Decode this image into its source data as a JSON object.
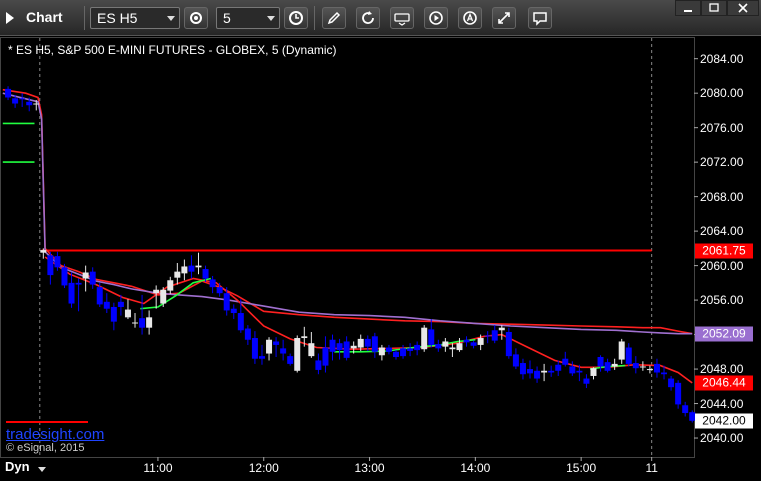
{
  "toolbar": {
    "title": "Chart",
    "symbol": "ES H5",
    "interval": "5"
  },
  "colors": {
    "up": "#e8e8e8",
    "down": "#0000ff",
    "ma_red": "#ff2020",
    "ma_violet": "#a070d0",
    "ma_green": "#20ff40",
    "level": "#ff0000"
  },
  "chart_data": {
    "type": "candlestick",
    "title": "* ES H5, S&P 500 E-MINI FUTURES - GLOBEX, 5 (Dynamic)",
    "watermark": "tradesight.com",
    "copyright": "© eSignal, 2015",
    "mode_label": "Dyn",
    "x_ticks": [
      "11:00",
      "12:00",
      "13:00",
      "14:00",
      "15:00",
      "11"
    ],
    "x_tick_minutes": [
      660,
      720,
      780,
      840,
      900,
      940
    ],
    "x_range_minutes": [
      571,
      964
    ],
    "y_ticks": [
      "2084.00",
      "2080.00",
      "2076.00",
      "2072.00",
      "2068.00",
      "2064.00",
      "2060.00",
      "2056.00",
      "2052.00",
      "2048.00",
      "2044.00",
      "2040.00"
    ],
    "ylim": [
      2037.8,
      2086.4
    ],
    "price_labels": [
      {
        "text": "2061.75",
        "value": 2061.75,
        "bg": "#ff0000",
        "fg": "#ffffff"
      },
      {
        "text": "2052.09",
        "value": 2052.09,
        "bg": "#9a6fd0",
        "fg": "#ffffff"
      },
      {
        "text": "2046.44",
        "value": 2046.44,
        "bg": "#ff0000",
        "fg": "#ffffff"
      },
      {
        "text": "2042.00",
        "value": 2042.0,
        "bg": "#ffffff",
        "fg": "#000000"
      }
    ],
    "horizontal_level": 2061.75,
    "candles": [
      [
        575,
        2080.5,
        2080.8,
        2079.2,
        2079.5
      ],
      [
        579,
        2079.4,
        2079.8,
        2078.3,
        2078.8
      ],
      [
        583,
        2079.4,
        2080.0,
        2078.4,
        2079.3
      ],
      [
        587,
        2079.0,
        2079.5,
        2077.9,
        2078.6
      ],
      [
        591,
        2078.8,
        2079.2,
        2078.0,
        2078.8
      ],
      [
        595,
        2061.5,
        2062.0,
        2060.8,
        2061.8
      ],
      [
        599,
        2061.2,
        2061.6,
        2057.8,
        2058.9
      ],
      [
        603,
        2061.1,
        2061.6,
        2059.4,
        2059.8
      ],
      [
        607,
        2059.8,
        2060.2,
        2057.4,
        2057.7
      ],
      [
        611,
        2058.0,
        2059.2,
        2055.1,
        2055.6
      ],
      [
        615,
        2058.0,
        2058.5,
        2054.7,
        2057.8
      ],
      [
        619,
        2058.5,
        2060.0,
        2057.0,
        2059.2
      ],
      [
        623,
        2059.3,
        2059.8,
        2057.3,
        2057.8
      ],
      [
        627,
        2057.5,
        2058.0,
        2055.2,
        2055.5
      ],
      [
        631,
        2055.8,
        2056.8,
        2054.5,
        2055.0
      ],
      [
        635,
        2055.2,
        2055.7,
        2052.5,
        2053.5
      ],
      [
        639,
        2055.8,
        2056.6,
        2054.2,
        2055.2
      ],
      [
        643,
        2054.0,
        2056.1,
        2053.8,
        2054.9
      ],
      [
        647,
        2053.3,
        2054.5,
        2052.8,
        2053.4
      ],
      [
        651,
        2053.9,
        2056.6,
        2052.0,
        2052.8
      ],
      [
        655,
        2052.8,
        2054.8,
        2052.0,
        2054.0
      ],
      [
        659,
        2056.8,
        2057.7,
        2055.0,
        2057.2
      ],
      [
        663,
        2055.6,
        2057.5,
        2055.2,
        2057.2
      ],
      [
        667,
        2057.1,
        2058.7,
        2056.7,
        2058.3
      ],
      [
        671,
        2058.6,
        2060.3,
        2057.8,
        2059.3
      ],
      [
        675,
        2059.1,
        2060.7,
        2058.3,
        2059.9
      ],
      [
        679,
        2060.0,
        2061.2,
        2058.5,
        2059.3
      ],
      [
        683,
        2059.8,
        2061.5,
        2059.0,
        2060.0
      ],
      [
        687,
        2059.6,
        2060.0,
        2058.1,
        2058.5
      ],
      [
        691,
        2058.4,
        2058.8,
        2056.8,
        2057.5
      ],
      [
        695,
        2057.5,
        2058.0,
        2056.4,
        2056.8
      ],
      [
        699,
        2056.8,
        2057.5,
        2054.2,
        2054.8
      ],
      [
        703,
        2055.0,
        2055.5,
        2053.8,
        2054.5
      ],
      [
        707,
        2054.5,
        2056.1,
        2052.2,
        2052.5
      ],
      [
        711,
        2052.7,
        2053.1,
        2050.8,
        2051.4
      ],
      [
        715,
        2051.6,
        2052.4,
        2048.6,
        2049.2
      ],
      [
        719,
        2049.5,
        2050.8,
        2048.5,
        2049.2
      ],
      [
        723,
        2049.8,
        2051.7,
        2049.0,
        2051.4
      ],
      [
        727,
        2051.2,
        2051.7,
        2049.4,
        2050.8
      ],
      [
        731,
        2050.4,
        2051.4,
        2049.0,
        2049.8
      ],
      [
        735,
        2049.5,
        2049.8,
        2048.4,
        2048.6
      ],
      [
        739,
        2047.8,
        2051.9,
        2047.6,
        2051.6
      ],
      [
        743,
        2051.6,
        2052.9,
        2050.6,
        2051.8
      ],
      [
        747,
        2049.5,
        2052.3,
        2049.3,
        2051.0
      ],
      [
        751,
        2049.0,
        2049.8,
        2047.4,
        2047.9
      ],
      [
        755,
        2050.5,
        2051.8,
        2047.6,
        2048.4
      ],
      [
        759,
        2051.4,
        2052.0,
        2049.0,
        2050.0
      ],
      [
        763,
        2051.0,
        2051.5,
        2049.1,
        2050.2
      ],
      [
        767,
        2051.2,
        2051.8,
        2049.0,
        2049.3
      ],
      [
        771,
        2050.4,
        2051.2,
        2049.8,
        2050.7
      ],
      [
        775,
        2050.5,
        2052.0,
        2050.1,
        2051.5
      ],
      [
        779,
        2051.5,
        2051.9,
        2050.1,
        2050.6
      ],
      [
        783,
        2051.8,
        2052.2,
        2049.3,
        2050.0
      ],
      [
        787,
        2049.6,
        2050.8,
        2049.0,
        2050.5
      ],
      [
        791,
        2050.5,
        2050.8,
        2049.7,
        2050.0
      ],
      [
        795,
        2050.0,
        2050.2,
        2049.1,
        2049.4
      ],
      [
        799,
        2050.4,
        2050.8,
        2049.2,
        2049.5
      ],
      [
        803,
        2050.4,
        2051.0,
        2049.5,
        2050.1
      ],
      [
        807,
        2050.8,
        2051.2,
        2049.6,
        2050.2
      ],
      [
        811,
        2050.3,
        2053.1,
        2050.0,
        2052.8
      ],
      [
        815,
        2052.6,
        2053.8,
        2050.5,
        2050.8
      ],
      [
        819,
        2050.9,
        2051.4,
        2050.0,
        2050.4
      ],
      [
        823,
        2050.6,
        2051.6,
        2050.0,
        2051.2
      ],
      [
        827,
        2050.3,
        2051.0,
        2049.4,
        2050.5
      ],
      [
        831,
        2050.2,
        2051.6,
        2050.0,
        2051.0
      ],
      [
        835,
        2051.4,
        2051.8,
        2050.6,
        2051.1
      ],
      [
        839,
        2051.1,
        2051.3,
        2050.4,
        2050.7
      ],
      [
        843,
        2050.8,
        2052.0,
        2050.2,
        2051.6
      ],
      [
        847,
        2051.9,
        2052.4,
        2051.0,
        2051.8
      ],
      [
        851,
        2052.5,
        2053.1,
        2051.0,
        2051.3
      ],
      [
        855,
        2052.5,
        2053.1,
        2051.4,
        2052.8
      ],
      [
        859,
        2052.3,
        2052.8,
        2049.2,
        2049.5
      ],
      [
        863,
        2049.7,
        2050.4,
        2048.0,
        2048.3
      ],
      [
        867,
        2048.7,
        2049.2,
        2046.8,
        2047.4
      ],
      [
        871,
        2048.0,
        2049.0,
        2046.9,
        2047.5
      ],
      [
        875,
        2047.8,
        2048.3,
        2046.4,
        2046.9
      ],
      [
        879,
        2047.6,
        2048.6,
        2046.6,
        2047.8
      ],
      [
        883,
        2047.8,
        2048.4,
        2047.1,
        2047.6
      ],
      [
        887,
        2048.5,
        2049.0,
        2047.2,
        2047.8
      ],
      [
        891,
        2049.2,
        2050.0,
        2048.3,
        2048.5
      ],
      [
        895,
        2048.3,
        2048.9,
        2047.2,
        2047.5
      ],
      [
        899,
        2047.8,
        2048.5,
        2046.6,
        2047.6
      ],
      [
        903,
        2046.9,
        2047.4,
        2045.8,
        2046.3
      ],
      [
        907,
        2047.2,
        2048.2,
        2046.8,
        2048.1
      ],
      [
        911,
        2049.4,
        2049.6,
        2047.7,
        2048.3
      ],
      [
        915,
        2048.8,
        2049.2,
        2047.6,
        2047.8
      ],
      [
        919,
        2048.3,
        2049.2,
        2047.9,
        2048.6
      ],
      [
        923,
        2049.1,
        2051.5,
        2048.6,
        2051.2
      ],
      [
        927,
        2050.5,
        2051.0,
        2048.3,
        2048.6
      ],
      [
        931,
        2048.7,
        2049.5,
        2047.5,
        2048.1
      ],
      [
        935,
        2048.3,
        2048.9,
        2047.8,
        2048.3
      ],
      [
        939,
        2048.0,
        2048.4,
        2047.5,
        2048.0
      ],
      [
        943,
        2048.6,
        2049.2,
        2047.0,
        2047.6
      ],
      [
        947,
        2047.6,
        2048.4,
        2046.8,
        2047.4
      ],
      [
        951,
        2046.9,
        2047.2,
        2045.5,
        2045.9
      ],
      [
        955,
        2046.4,
        2046.7,
        2043.4,
        2043.9
      ],
      [
        959,
        2043.8,
        2044.2,
        2042.5,
        2042.9
      ],
      [
        963,
        2043.0,
        2043.2,
        2041.8,
        2042.0
      ]
    ],
    "series": [
      {
        "color": "#ff2020",
        "points": [
          [
            572,
            2080.4
          ],
          [
            585,
            2080.0
          ],
          [
            592,
            2079.5
          ],
          [
            594,
            2077.5
          ],
          [
            596,
            2062.0
          ],
          [
            605,
            2060.0
          ],
          [
            615,
            2059.3
          ],
          [
            625,
            2058.4
          ],
          [
            635,
            2058.0
          ],
          [
            645,
            2057.6
          ],
          [
            660,
            2056.6
          ],
          [
            672,
            2056.8
          ],
          [
            685,
            2058.2
          ],
          [
            695,
            2057.5
          ],
          [
            705,
            2056.5
          ],
          [
            720,
            2054.7
          ],
          [
            740,
            2054.3
          ],
          [
            760,
            2054.0
          ],
          [
            780,
            2053.8
          ],
          [
            800,
            2053.6
          ],
          [
            820,
            2053.5
          ],
          [
            840,
            2053.3
          ],
          [
            860,
            2053.2
          ],
          [
            880,
            2053.1
          ],
          [
            900,
            2053.0
          ],
          [
            920,
            2052.9
          ],
          [
            935,
            2052.8
          ],
          [
            945,
            2052.8
          ],
          [
            955,
            2052.4
          ],
          [
            963,
            2052.1
          ]
        ]
      },
      {
        "color": "#a070d0",
        "points": [
          [
            572,
            2080.0
          ],
          [
            592,
            2079.0
          ],
          [
            594,
            2077.0
          ],
          [
            596,
            2061.6
          ],
          [
            605,
            2059.8
          ],
          [
            615,
            2059.0
          ],
          [
            625,
            2058.2
          ],
          [
            635,
            2057.8
          ],
          [
            645,
            2057.3
          ],
          [
            660,
            2056.8
          ],
          [
            672,
            2056.6
          ],
          [
            685,
            2056.4
          ],
          [
            700,
            2056.0
          ],
          [
            720,
            2055.3
          ],
          [
            740,
            2054.6
          ],
          [
            760,
            2054.3
          ],
          [
            780,
            2054.2
          ],
          [
            800,
            2054.0
          ],
          [
            820,
            2053.6
          ],
          [
            840,
            2053.3
          ],
          [
            860,
            2053.0
          ],
          [
            880,
            2052.8
          ],
          [
            900,
            2052.6
          ],
          [
            920,
            2052.5
          ],
          [
            935,
            2052.3
          ],
          [
            945,
            2052.2
          ],
          [
            955,
            2052.1
          ],
          [
            963,
            2052.1
          ]
        ]
      },
      {
        "color": "#ff2020",
        "points": [
          [
            596,
            2061.0
          ],
          [
            610,
            2059.0
          ],
          [
            625,
            2057.8
          ],
          [
            640,
            2056.3
          ],
          [
            652,
            2055.6
          ],
          [
            665,
            2057.5
          ],
          [
            680,
            2058.5
          ],
          [
            693,
            2058.0
          ],
          [
            705,
            2056.0
          ],
          [
            720,
            2053.0
          ],
          [
            735,
            2051.5
          ],
          [
            750,
            2050.5
          ],
          [
            770,
            2050.3
          ],
          [
            790,
            2050.4
          ],
          [
            810,
            2050.5
          ],
          [
            830,
            2051.0
          ],
          [
            845,
            2051.8
          ],
          [
            855,
            2052.0
          ],
          [
            870,
            2050.5
          ],
          [
            885,
            2049.0
          ],
          [
            900,
            2048.2
          ],
          [
            915,
            2048.2
          ],
          [
            930,
            2048.5
          ],
          [
            945,
            2048.4
          ],
          [
            955,
            2047.6
          ],
          [
            963,
            2046.4
          ]
        ]
      },
      {
        "color": "#20ff40",
        "points": [
          [
            572,
            2076.5
          ],
          [
            590,
            2076.5
          ]
        ]
      },
      {
        "color": "#20ff40",
        "points": [
          [
            572,
            2072.0
          ],
          [
            590,
            2072.0
          ]
        ]
      },
      {
        "color": "#20ff40",
        "points": [
          [
            650,
            2055.0
          ],
          [
            660,
            2055.2
          ],
          [
            670,
            2056.5
          ],
          [
            680,
            2058.0
          ],
          [
            690,
            2058.5
          ]
        ]
      },
      {
        "color": "#20ff40",
        "points": [
          [
            760,
            2050.0
          ],
          [
            775,
            2050.0
          ],
          [
            790,
            2050.1
          ],
          [
            805,
            2050.5
          ],
          [
            820,
            2050.8
          ],
          [
            830,
            2051.2
          ],
          [
            840,
            2051.4
          ]
        ]
      },
      {
        "color": "#20ff40",
        "points": [
          [
            905,
            2048.0
          ],
          [
            915,
            2048.3
          ],
          [
            925,
            2048.4
          ]
        ]
      }
    ]
  }
}
